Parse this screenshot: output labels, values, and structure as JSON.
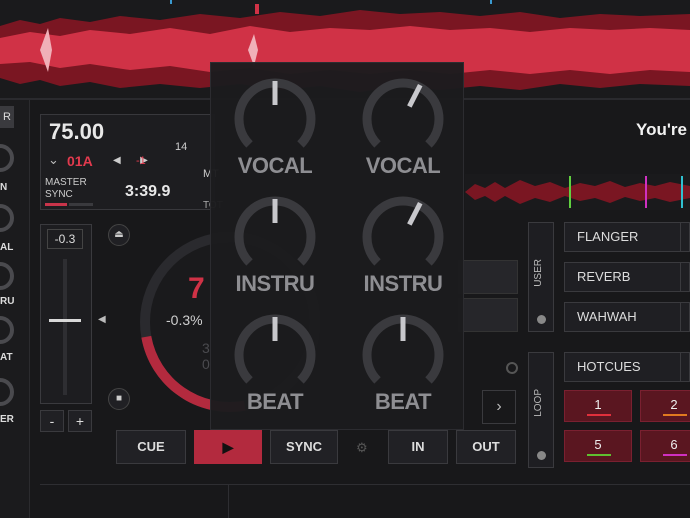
{
  "deck": {
    "bpm": "75.00",
    "key": "01A",
    "pitch_offset": "-1",
    "badge_14": "14",
    "mt_label": "MT",
    "sync_label_1": "MASTER",
    "sync_label_2": "SYNC",
    "time": "3:39.9",
    "tot_label": "TOT",
    "pitch_readout": "-0.3",
    "platter_number": "7",
    "platter_pct": "-0.3%",
    "platter_dim_1": "3",
    "platter_dim_2": "0",
    "minus": "-",
    "plus": "+",
    "track_title": "You're"
  },
  "left_strip": {
    "tab": "R",
    "labels": [
      "N",
      "AL",
      "RU",
      "AT",
      "ER"
    ]
  },
  "transport": {
    "cue": "CUE",
    "play": "▶",
    "sync": "SYNC",
    "in": "IN",
    "out": "OUT"
  },
  "side_panels": {
    "user": "USER",
    "loop": "LOOP"
  },
  "effects": [
    "FLANGER",
    "REVERB",
    "WAHWAH"
  ],
  "hotcues_label": "HOTCUES",
  "hotcues": [
    {
      "label": "1",
      "color": "#e0303c"
    },
    {
      "label": "2",
      "color": "#e07a20"
    },
    {
      "label": "5",
      "color": "#60c030"
    },
    {
      "label": "6",
      "color": "#d030c0"
    }
  ],
  "stems": {
    "rows": [
      {
        "label": "VOCAL",
        "left_level": 0.5,
        "right_level": 0.6
      },
      {
        "label": "INSTRU",
        "left_level": 0.5,
        "right_level": 0.6
      },
      {
        "label": "BEAT",
        "left_level": 0.5,
        "right_level": 0.5
      }
    ]
  },
  "colors": {
    "accent": "#b32a3e",
    "waveform": "#d03246",
    "waveform_dark": "#7a1622"
  }
}
